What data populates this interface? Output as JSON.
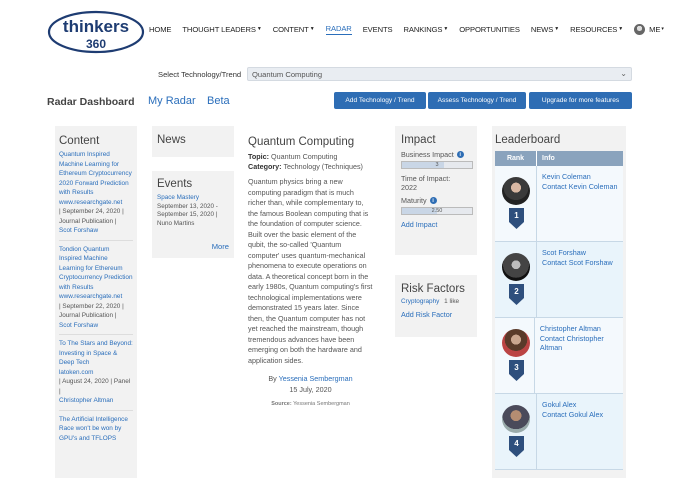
{
  "brand": {
    "line1": "thinkers",
    "line2": "360",
    "color": "#1e3c72"
  },
  "nav": [
    {
      "label": "HOME",
      "caret": false
    },
    {
      "label": "THOUGHT LEADERS",
      "caret": true
    },
    {
      "label": "CONTENT",
      "caret": true
    },
    {
      "label": "RADAR",
      "caret": false,
      "active": true
    },
    {
      "label": "EVENTS",
      "caret": false
    },
    {
      "label": "RANKINGS",
      "caret": true
    },
    {
      "label": "OPPORTUNITIES",
      "caret": false
    },
    {
      "label": "NEWS",
      "caret": true
    },
    {
      "label": "RESOURCES",
      "caret": true
    }
  ],
  "user": {
    "label": "ME",
    "caret": "▾"
  },
  "selector": {
    "label": "Select Technology/Trend",
    "value": "Quantum Computing"
  },
  "dashboard": {
    "title": "Radar Dashboard",
    "my_radar": "My Radar",
    "beta": "Beta"
  },
  "buttons": {
    "add": "Add Technology / Trend",
    "assess": "Assess Technology / Trend",
    "upgrade": "Upgrade for more features"
  },
  "content_panel": {
    "title": "Content",
    "items": [
      {
        "title": "Quantum Inspired Machine Learning for Ethereum Cryptocurrency 2020 Forward Prediction with Results",
        "source": "www.researchgate.net",
        "meta": "| September 24, 2020 | Journal Publication |",
        "author": "Scot Forshaw"
      },
      {
        "title": "Tondion Quantum Inspired Machine Learning for Ethereum Cryptocurrency Prediction with Results",
        "source": "www.researchgate.net",
        "meta": "| September 22, 2020 | Journal Publication |",
        "author": "Scot Forshaw"
      },
      {
        "title": "To The Stars and Beyond: Investing in Space & Deep Tech",
        "source": "latoken.com",
        "meta": "| August 24, 2020 | Panel |",
        "author": "Christopher Altman"
      },
      {
        "title": "The Artificial Intelligence Race won't be won by GPU's and TFLOPS",
        "source": "",
        "meta": "",
        "author": ""
      }
    ]
  },
  "news_panel": {
    "title": "News"
  },
  "events_panel": {
    "title": "Events",
    "event_name": "Space Mastery",
    "dates": "September 13, 2020 - September 15, 2020 |",
    "person": "Nuno Martins",
    "more": "More"
  },
  "article": {
    "title": "Quantum Computing",
    "topic_label": "Topic:",
    "topic": "Quantum Computing",
    "category_label": "Category:",
    "category": "Technology (Techniques)",
    "body": "Quantum physics bring a new computing paradigm that is much richer than, while complementary to, the famous Boolean computing that is the foundation of computer science. Built over the basic element of the qubit, the so-called 'Quantum computer' uses quantum-mechanical phenomena to execute operations on data. A theoretical concept born in the early 1980s, Quantum computing's first technological implementations were demonstrated 15 years later. Since then, the Quantum computer has not yet reached the mainstream, though tremendous advances have been emerging on both the hardware and application sides.",
    "by": "By",
    "author": "Yessenia Sembergman",
    "date": "15 July, 2020",
    "source_label": "Source:",
    "source": "Yessenia Sembergman"
  },
  "impact": {
    "title": "Impact",
    "business_label": "Business Impact",
    "business_value": "3",
    "business_fraction": 0.6,
    "time_label": "Time of Impact:",
    "time_value": "2022",
    "maturity_label": "Maturity",
    "maturity_value": "2.50",
    "maturity_fraction": 0.5,
    "add": "Add Impact"
  },
  "risk": {
    "title": "Risk Factors",
    "tag": "Cryptography",
    "likes": "1 like",
    "add": "Add Risk Factor"
  },
  "leaderboard": {
    "title": "Leaderboard",
    "col_rank": "Rank",
    "col_info": "Info",
    "rows": [
      {
        "rank": "1",
        "name": "Kevin Coleman",
        "contact": "Contact Kevin Coleman"
      },
      {
        "rank": "2",
        "name": "Scot Forshaw",
        "contact": "Contact Scot Forshaw"
      },
      {
        "rank": "3",
        "name": "Christopher Altman",
        "contact": "Contact Christopher Altman"
      },
      {
        "rank": "4",
        "name": "Gokul Alex",
        "contact": "Contact Gokul Alex"
      }
    ]
  },
  "colors": {
    "accent": "#2a6ebb",
    "button": "#2e6db4",
    "header": "#8aa3bd",
    "ribbon": "#2e4f7d"
  }
}
